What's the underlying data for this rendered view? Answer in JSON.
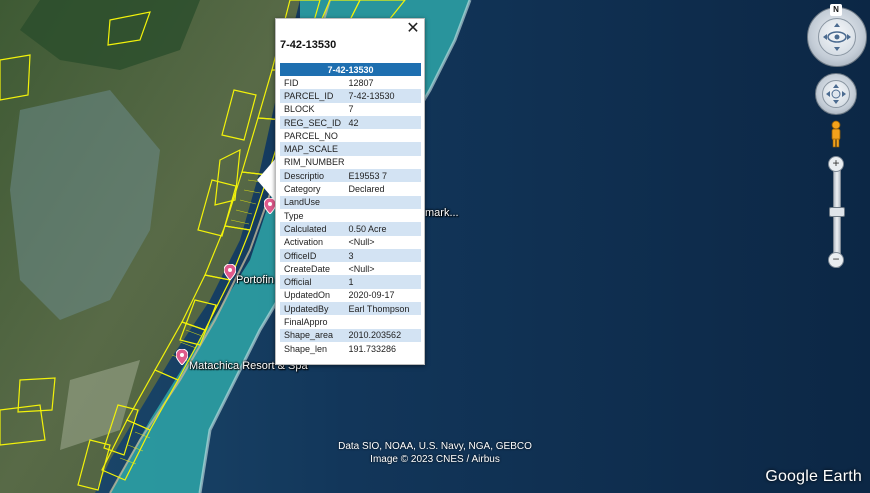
{
  "map": {
    "labels": [
      {
        "name": "landmark-label-partial",
        "text": "mark..."
      },
      {
        "name": "portofino-label",
        "text": "Portofin"
      },
      {
        "name": "matachica-label",
        "text": "Matachica Resort & Spa"
      }
    ],
    "attribution_line1": "Data SIO, NOAA, U.S. Navy, NGA, GEBCO",
    "attribution_line2": "Image © 2023 CNES / Airbus",
    "brand": "Google Earth",
    "parcel_outline_color": "#f2f20a",
    "ocean_color": "#0d2a4a",
    "reef_color": "#2ea6a8"
  },
  "navigation": {
    "north_label": "N",
    "zoom_in_label": "+",
    "zoom_out_label": "−",
    "compass_icon": "look-around-icon",
    "pan_icon": "move-arrows-icon",
    "street_view_icon": "pegman-icon"
  },
  "popup": {
    "title": "7-42-13530",
    "close_label": "✕",
    "header": "7-42-13530",
    "rows": [
      {
        "key": "FID",
        "value": "12807"
      },
      {
        "key": "PARCEL_ID",
        "value": "7-42-13530"
      },
      {
        "key": "BLOCK",
        "value": "7"
      },
      {
        "key": "REG_SEC_ID",
        "value": "42"
      },
      {
        "key": "PARCEL_NO",
        "value": ""
      },
      {
        "key": "MAP_SCALE",
        "value": ""
      },
      {
        "key": "RIM_NUMBER",
        "value": ""
      },
      {
        "key": "Descriptio",
        "value": "E19553 7"
      },
      {
        "key": "Category",
        "value": "Declared"
      },
      {
        "key": "LandUse",
        "value": ""
      },
      {
        "key": "Type",
        "value": ""
      },
      {
        "key": "Calculated",
        "value": "0.50 Acre"
      },
      {
        "key": "Activation",
        "value": "<Null>"
      },
      {
        "key": "OfficeID",
        "value": "3"
      },
      {
        "key": "CreateDate",
        "value": "<Null>"
      },
      {
        "key": "Official",
        "value": "1"
      },
      {
        "key": "UpdatedOn",
        "value": "2020-09-17"
      },
      {
        "key": "UpdatedBy",
        "value": "Earl Thompson"
      },
      {
        "key": "FinalAppro",
        "value": ""
      },
      {
        "key": "Shape_area",
        "value": "2010.203562"
      },
      {
        "key": "Shape_len",
        "value": "191.733286"
      }
    ]
  }
}
